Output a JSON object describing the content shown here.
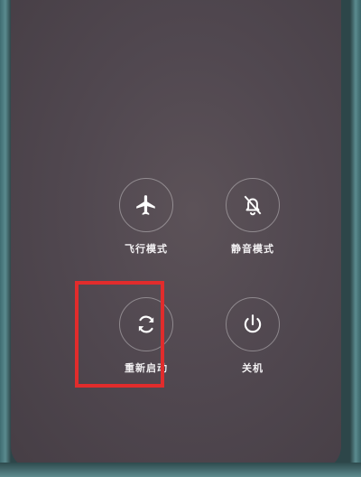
{
  "power_menu": {
    "airplane_mode": {
      "label": "飞行模式",
      "icon": "airplane-icon"
    },
    "silent_mode": {
      "label": "静音模式",
      "icon": "bell-off-icon"
    },
    "restart": {
      "label": "重新启动",
      "icon": "restart-icon"
    },
    "power_off": {
      "label": "关机",
      "icon": "power-icon"
    }
  },
  "highlight_color": "#e12c2c",
  "background_color": "#514850"
}
